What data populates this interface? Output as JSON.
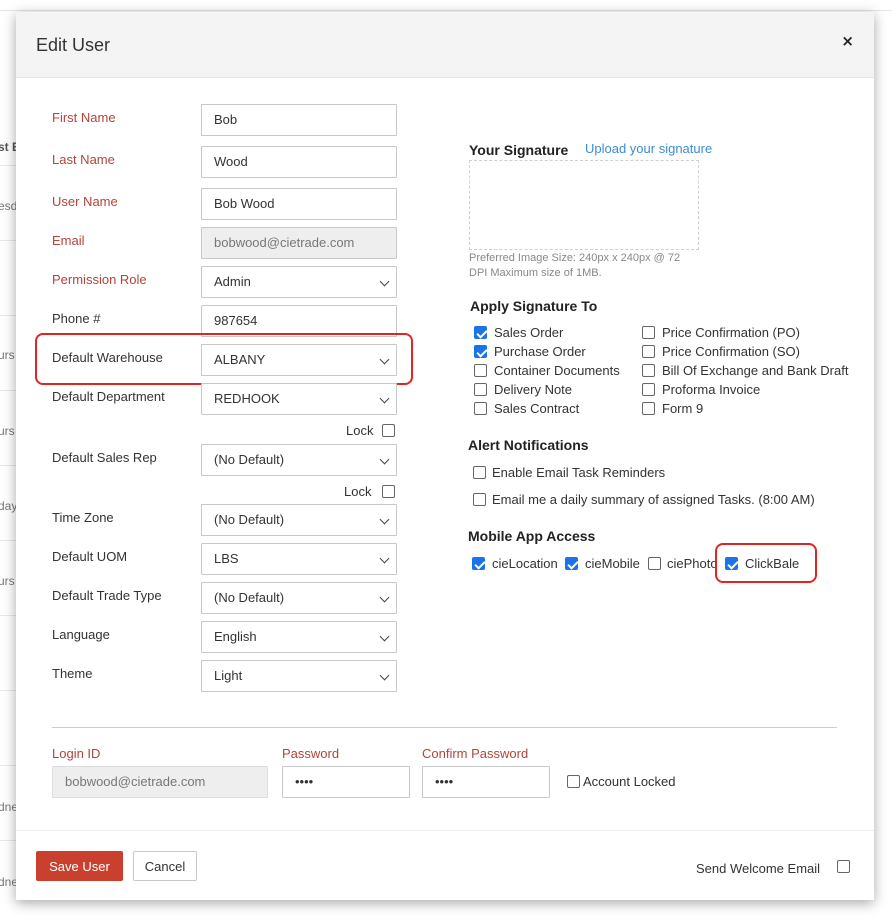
{
  "background": {
    "fragments": [
      "st E",
      "esd",
      "urs",
      "urs",
      "day",
      "urs",
      "dne",
      "dne"
    ]
  },
  "dialog": {
    "title": "Edit User",
    "close_symbol": "×"
  },
  "form": {
    "first_name": {
      "label": "First Name",
      "value": "Bob"
    },
    "last_name": {
      "label": "Last Name",
      "value": "Wood"
    },
    "user_name": {
      "label": "User Name",
      "value": "Bob Wood"
    },
    "email": {
      "label": "Email",
      "value": "bobwood@cietrade.com"
    },
    "permission_role": {
      "label": "Permission Role",
      "value": "Admin"
    },
    "phone": {
      "label": "Phone #",
      "value": "987654"
    },
    "default_warehouse": {
      "label": "Default Warehouse",
      "value": "ALBANY"
    },
    "default_department": {
      "label": "Default Department",
      "value": "REDHOOK",
      "lock_label": "Lock",
      "locked": false
    },
    "default_sales_rep": {
      "label": "Default Sales Rep",
      "value": "(No Default)",
      "lock_label": "Lock",
      "locked": false
    },
    "time_zone": {
      "label": "Time Zone",
      "value": "(No Default)"
    },
    "default_uom": {
      "label": "Default UOM",
      "value": "LBS"
    },
    "default_trade_type": {
      "label": "Default Trade Type",
      "value": "(No Default)"
    },
    "language": {
      "label": "Language",
      "value": "English"
    },
    "theme": {
      "label": "Theme",
      "value": "Light"
    }
  },
  "signature": {
    "title": "Your Signature",
    "upload_link": "Upload your signature",
    "note_line1": "Preferred Image Size: 240px x 240px @ 72",
    "note_line2": "DPI Maximum size of 1MB."
  },
  "apply_signature": {
    "title": "Apply Signature To",
    "left": [
      {
        "label": "Sales Order",
        "checked": true
      },
      {
        "label": "Purchase Order",
        "checked": true
      },
      {
        "label": "Container Documents",
        "checked": false
      },
      {
        "label": "Delivery Note",
        "checked": false
      },
      {
        "label": "Sales Contract",
        "checked": false
      }
    ],
    "right": [
      {
        "label": "Price Confirmation (PO)",
        "checked": false
      },
      {
        "label": "Price Confirmation (SO)",
        "checked": false
      },
      {
        "label": "Bill Of Exchange and Bank Draft",
        "checked": false
      },
      {
        "label": "Proforma Invoice",
        "checked": false
      },
      {
        "label": "Form 9",
        "checked": false
      }
    ]
  },
  "alerts": {
    "title": "Alert Notifications",
    "items": [
      {
        "label": "Enable Email Task Reminders",
        "checked": false
      },
      {
        "label": "Email me a daily summary of assigned Tasks. (8:00 AM)",
        "checked": false
      }
    ]
  },
  "mobile": {
    "title": "Mobile App Access",
    "items": [
      {
        "label": "cieLocation",
        "checked": true
      },
      {
        "label": "cieMobile",
        "checked": true
      },
      {
        "label": "ciePhoto",
        "checked": false
      },
      {
        "label": "ClickBale",
        "checked": true
      }
    ]
  },
  "login": {
    "login_id": {
      "label": "Login ID",
      "value": "bobwood@cietrade.com"
    },
    "password": {
      "label": "Password",
      "value": "••••"
    },
    "confirm_password": {
      "label": "Confirm Password",
      "value": "••••"
    },
    "account_locked": {
      "label": "Account Locked",
      "checked": false
    }
  },
  "footer": {
    "save_label": "Save User",
    "cancel_label": "Cancel",
    "welcome_label": "Send Welcome Email",
    "welcome_checked": false
  },
  "colors": {
    "required_label": "#b3443a",
    "highlight": "#e02525",
    "checkbox_checked": "#1a73e8",
    "save_button": "#c9412e",
    "link": "#3d8ccf"
  }
}
